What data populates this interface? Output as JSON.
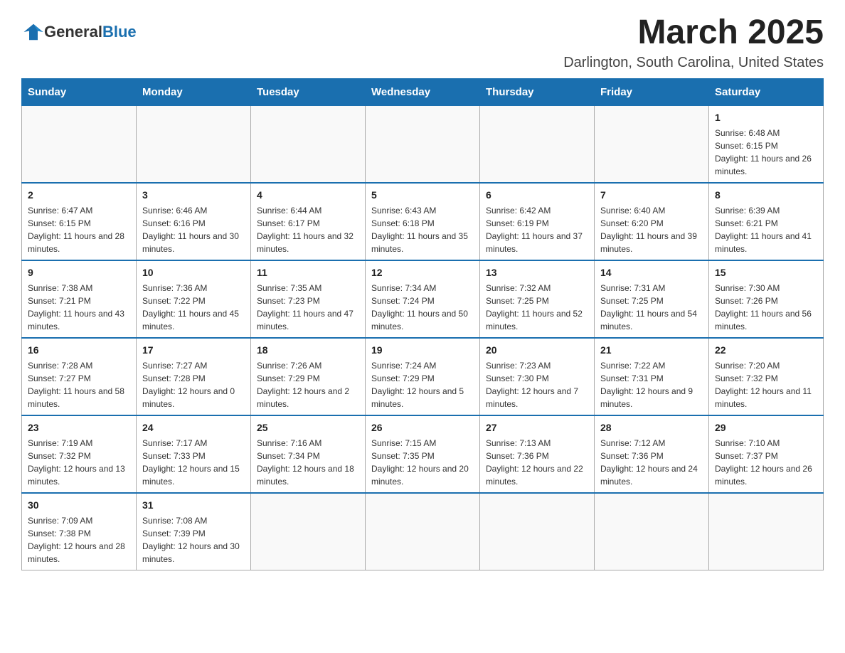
{
  "title": "March 2025",
  "location": "Darlington, South Carolina, United States",
  "logo": {
    "general": "General",
    "blue": "Blue"
  },
  "days_of_week": [
    "Sunday",
    "Monday",
    "Tuesday",
    "Wednesday",
    "Thursday",
    "Friday",
    "Saturday"
  ],
  "weeks": [
    [
      {
        "day": "",
        "info": ""
      },
      {
        "day": "",
        "info": ""
      },
      {
        "day": "",
        "info": ""
      },
      {
        "day": "",
        "info": ""
      },
      {
        "day": "",
        "info": ""
      },
      {
        "day": "",
        "info": ""
      },
      {
        "day": "1",
        "info": "Sunrise: 6:48 AM\nSunset: 6:15 PM\nDaylight: 11 hours and 26 minutes."
      }
    ],
    [
      {
        "day": "2",
        "info": "Sunrise: 6:47 AM\nSunset: 6:15 PM\nDaylight: 11 hours and 28 minutes."
      },
      {
        "day": "3",
        "info": "Sunrise: 6:46 AM\nSunset: 6:16 PM\nDaylight: 11 hours and 30 minutes."
      },
      {
        "day": "4",
        "info": "Sunrise: 6:44 AM\nSunset: 6:17 PM\nDaylight: 11 hours and 32 minutes."
      },
      {
        "day": "5",
        "info": "Sunrise: 6:43 AM\nSunset: 6:18 PM\nDaylight: 11 hours and 35 minutes."
      },
      {
        "day": "6",
        "info": "Sunrise: 6:42 AM\nSunset: 6:19 PM\nDaylight: 11 hours and 37 minutes."
      },
      {
        "day": "7",
        "info": "Sunrise: 6:40 AM\nSunset: 6:20 PM\nDaylight: 11 hours and 39 minutes."
      },
      {
        "day": "8",
        "info": "Sunrise: 6:39 AM\nSunset: 6:21 PM\nDaylight: 11 hours and 41 minutes."
      }
    ],
    [
      {
        "day": "9",
        "info": "Sunrise: 7:38 AM\nSunset: 7:21 PM\nDaylight: 11 hours and 43 minutes."
      },
      {
        "day": "10",
        "info": "Sunrise: 7:36 AM\nSunset: 7:22 PM\nDaylight: 11 hours and 45 minutes."
      },
      {
        "day": "11",
        "info": "Sunrise: 7:35 AM\nSunset: 7:23 PM\nDaylight: 11 hours and 47 minutes."
      },
      {
        "day": "12",
        "info": "Sunrise: 7:34 AM\nSunset: 7:24 PM\nDaylight: 11 hours and 50 minutes."
      },
      {
        "day": "13",
        "info": "Sunrise: 7:32 AM\nSunset: 7:25 PM\nDaylight: 11 hours and 52 minutes."
      },
      {
        "day": "14",
        "info": "Sunrise: 7:31 AM\nSunset: 7:25 PM\nDaylight: 11 hours and 54 minutes."
      },
      {
        "day": "15",
        "info": "Sunrise: 7:30 AM\nSunset: 7:26 PM\nDaylight: 11 hours and 56 minutes."
      }
    ],
    [
      {
        "day": "16",
        "info": "Sunrise: 7:28 AM\nSunset: 7:27 PM\nDaylight: 11 hours and 58 minutes."
      },
      {
        "day": "17",
        "info": "Sunrise: 7:27 AM\nSunset: 7:28 PM\nDaylight: 12 hours and 0 minutes."
      },
      {
        "day": "18",
        "info": "Sunrise: 7:26 AM\nSunset: 7:29 PM\nDaylight: 12 hours and 2 minutes."
      },
      {
        "day": "19",
        "info": "Sunrise: 7:24 AM\nSunset: 7:29 PM\nDaylight: 12 hours and 5 minutes."
      },
      {
        "day": "20",
        "info": "Sunrise: 7:23 AM\nSunset: 7:30 PM\nDaylight: 12 hours and 7 minutes."
      },
      {
        "day": "21",
        "info": "Sunrise: 7:22 AM\nSunset: 7:31 PM\nDaylight: 12 hours and 9 minutes."
      },
      {
        "day": "22",
        "info": "Sunrise: 7:20 AM\nSunset: 7:32 PM\nDaylight: 12 hours and 11 minutes."
      }
    ],
    [
      {
        "day": "23",
        "info": "Sunrise: 7:19 AM\nSunset: 7:32 PM\nDaylight: 12 hours and 13 minutes."
      },
      {
        "day": "24",
        "info": "Sunrise: 7:17 AM\nSunset: 7:33 PM\nDaylight: 12 hours and 15 minutes."
      },
      {
        "day": "25",
        "info": "Sunrise: 7:16 AM\nSunset: 7:34 PM\nDaylight: 12 hours and 18 minutes."
      },
      {
        "day": "26",
        "info": "Sunrise: 7:15 AM\nSunset: 7:35 PM\nDaylight: 12 hours and 20 minutes."
      },
      {
        "day": "27",
        "info": "Sunrise: 7:13 AM\nSunset: 7:36 PM\nDaylight: 12 hours and 22 minutes."
      },
      {
        "day": "28",
        "info": "Sunrise: 7:12 AM\nSunset: 7:36 PM\nDaylight: 12 hours and 24 minutes."
      },
      {
        "day": "29",
        "info": "Sunrise: 7:10 AM\nSunset: 7:37 PM\nDaylight: 12 hours and 26 minutes."
      }
    ],
    [
      {
        "day": "30",
        "info": "Sunrise: 7:09 AM\nSunset: 7:38 PM\nDaylight: 12 hours and 28 minutes."
      },
      {
        "day": "31",
        "info": "Sunrise: 7:08 AM\nSunset: 7:39 PM\nDaylight: 12 hours and 30 minutes."
      },
      {
        "day": "",
        "info": ""
      },
      {
        "day": "",
        "info": ""
      },
      {
        "day": "",
        "info": ""
      },
      {
        "day": "",
        "info": ""
      },
      {
        "day": "",
        "info": ""
      }
    ]
  ]
}
